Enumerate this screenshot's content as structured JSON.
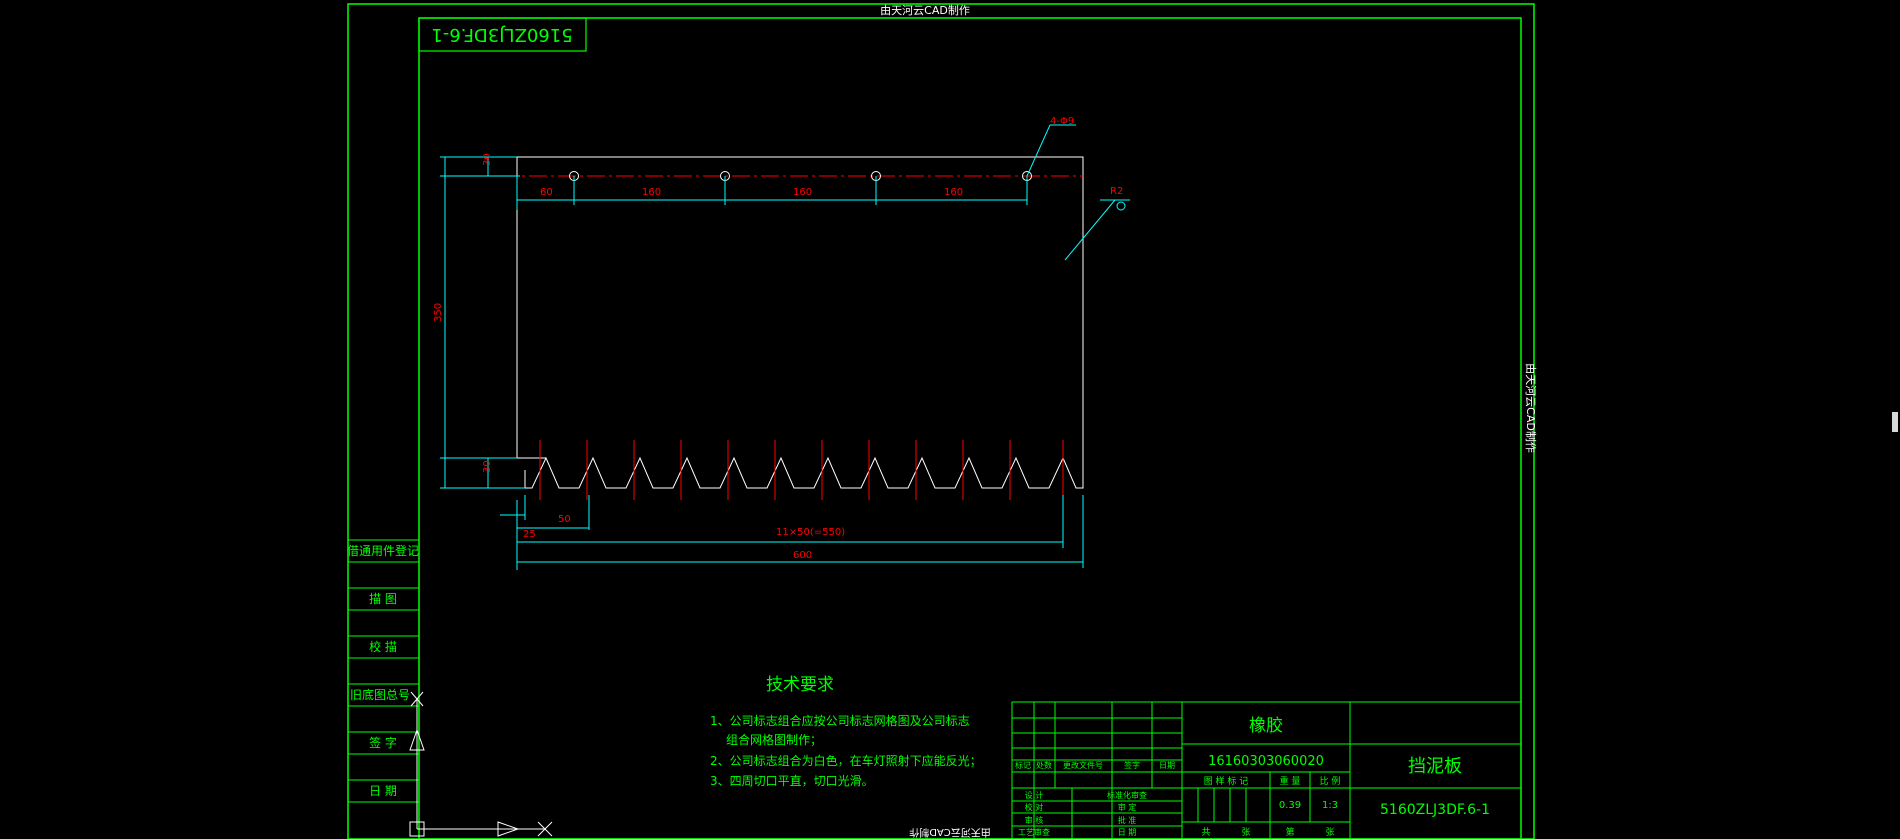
{
  "app": {
    "colors": {
      "background": "#000000",
      "frame": "#00ff00",
      "dimension": "#00ffff",
      "outline": "#ffffff",
      "centerline": "#ff0000",
      "callout": "#ff0000"
    }
  },
  "drawing": {
    "watermark_top": "由天河云CAD制作",
    "watermark_right": "由天河云CAD制作",
    "watermark_bottom": "由天河云CAD制作",
    "mirrored_code": "5160ZLJ3DF.6-1",
    "callouts": {
      "holes": "4-Φ9",
      "radius": "R2"
    },
    "dimensions": {
      "left_top": "30",
      "height": "350",
      "left_bottom": "30",
      "offset_first_hole": "60",
      "pitch_1": "160",
      "pitch_2": "160",
      "pitch_3": "160",
      "tooth_start": "25",
      "tooth_pitch": "50",
      "teeth_span": "11×50(=550)",
      "width": "600"
    },
    "tech_requirements": {
      "title": "技术要求",
      "lines": [
        "1、公司标志组合应按公司标志网格图及公司标志",
        "组合网格图制作；",
        "2、公司标志组合为白色，在车灯照射下应能反光；",
        "3、四周切口平直，切口光滑。"
      ]
    }
  },
  "side_panel": {
    "labels": [
      "借通用件登记",
      "描 图",
      "校 描",
      "旧底图总号",
      "签 字",
      "日 期"
    ]
  },
  "title_block": {
    "material": "橡胶",
    "part_number": "16160303060020",
    "part_name": "挡泥板",
    "drawing_number": "5160ZLJ3DF.6-1",
    "mark_label": "图 样 标 记",
    "weight_label": "重 量",
    "scale_label": "比 例",
    "weight": "0.39",
    "scale": "1:3",
    "sheet_total": "共",
    "sheet_no": "张",
    "sheet_word": "第",
    "sheet_word2": "张",
    "rev_headers": [
      "标记",
      "处数",
      "更改文件号",
      "签字",
      "日期"
    ],
    "roles": [
      "设 计",
      "校 对",
      "审 核",
      "工艺审查"
    ],
    "roles2": [
      "标准化审查",
      "审 定",
      "批 准",
      "日 期"
    ]
  }
}
